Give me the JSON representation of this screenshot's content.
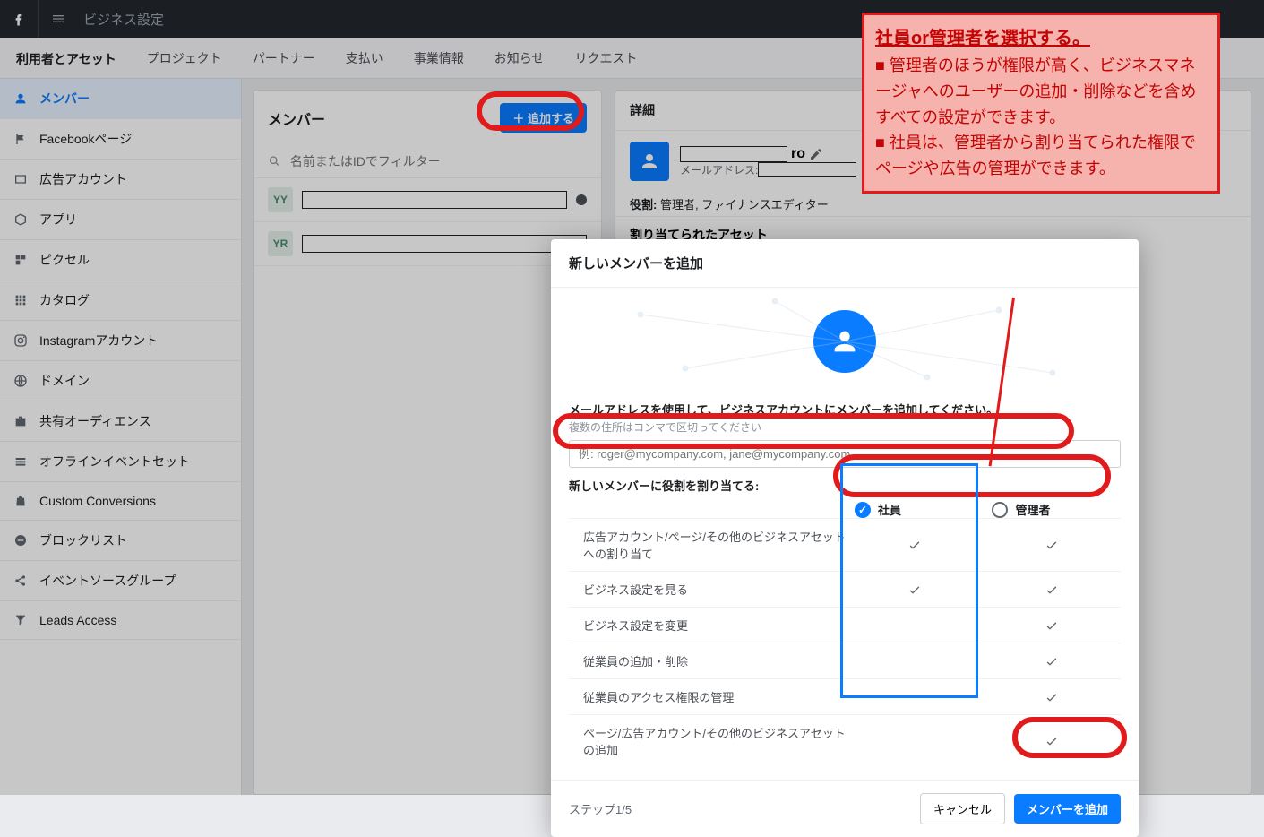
{
  "topbar": {
    "title": "ビジネス設定"
  },
  "tabs": {
    "items": [
      "利用者とアセット",
      "プロジェクト",
      "パートナー",
      "支払い",
      "事業情報",
      "お知らせ",
      "リクエスト"
    ],
    "active": 0
  },
  "sidebar": {
    "items": [
      {
        "label": "メンバー",
        "icon": "person-icon"
      },
      {
        "label": "Facebookページ",
        "icon": "flag-icon"
      },
      {
        "label": "広告アカウント",
        "icon": "rect-icon"
      },
      {
        "label": "アプリ",
        "icon": "cube-icon"
      },
      {
        "label": "ピクセル",
        "icon": "pixel-icon"
      },
      {
        "label": "カタログ",
        "icon": "grid-icon"
      },
      {
        "label": "Instagramアカウント",
        "icon": "instagram-icon"
      },
      {
        "label": "ドメイン",
        "icon": "globe-icon"
      },
      {
        "label": "共有オーディエンス",
        "icon": "briefcase-icon"
      },
      {
        "label": "オフラインイベントセット",
        "icon": "stack-icon"
      },
      {
        "label": "Custom Conversions",
        "icon": "bag-icon"
      },
      {
        "label": "ブロックリスト",
        "icon": "minus-circle-icon"
      },
      {
        "label": "イベントソースグループ",
        "icon": "share-icon"
      },
      {
        "label": "Leads Access",
        "icon": "funnel-icon"
      }
    ],
    "active": 0
  },
  "memberPanel": {
    "title": "メンバー",
    "add": "追加する",
    "searchPlaceholder": "名前またはIDでフィルター",
    "rows": [
      {
        "initials": "YY"
      },
      {
        "initials": "YR"
      }
    ]
  },
  "detail": {
    "header": "詳細",
    "nameSuffix": "ro",
    "emailLabel": "メールアドレス:",
    "roleLabel": "役割:",
    "roleValue": "管理者, ファイナンスエディター",
    "assetsHeader": "割り当てられたアセット"
  },
  "modal": {
    "title": "新しいメンバーを追加",
    "instruction": "メールアドレスを使用して、ビジネスアカウントにメンバーを追加してください。",
    "sub": "複数の住所はコンマで区切ってください",
    "emailPlaceholder": "例: roger@mycompany.com, jane@mycompany.com",
    "assignLabel": "新しいメンバーに役割を割り当てる:",
    "role1": "社員",
    "role2": "管理者",
    "perms": [
      "広告アカウント/ページ/その他のビジネスアセットへの割り当て",
      "ビジネス設定を見る",
      "ビジネス設定を変更",
      "従業員の追加・削除",
      "従業員のアクセス権限の管理",
      "ページ/広告アカウント/その他のビジネスアセットの追加"
    ],
    "employeeChecks": [
      true,
      true,
      false,
      false,
      false,
      false
    ],
    "adminChecks": [
      true,
      true,
      true,
      true,
      true,
      true
    ],
    "step": "ステップ1/5",
    "cancel": "キャンセル",
    "submit": "メンバーを追加"
  },
  "annotation": {
    "headline": "社員or管理者を選択する。",
    "body1": "■ 管理者のほうが権限が高く、ビジネスマネージャへのユーザーの追加・削除などを含めすべての設定ができます。",
    "body2": "■ 社員は、管理者から割り当てられた権限でページや広告の管理ができます。"
  }
}
